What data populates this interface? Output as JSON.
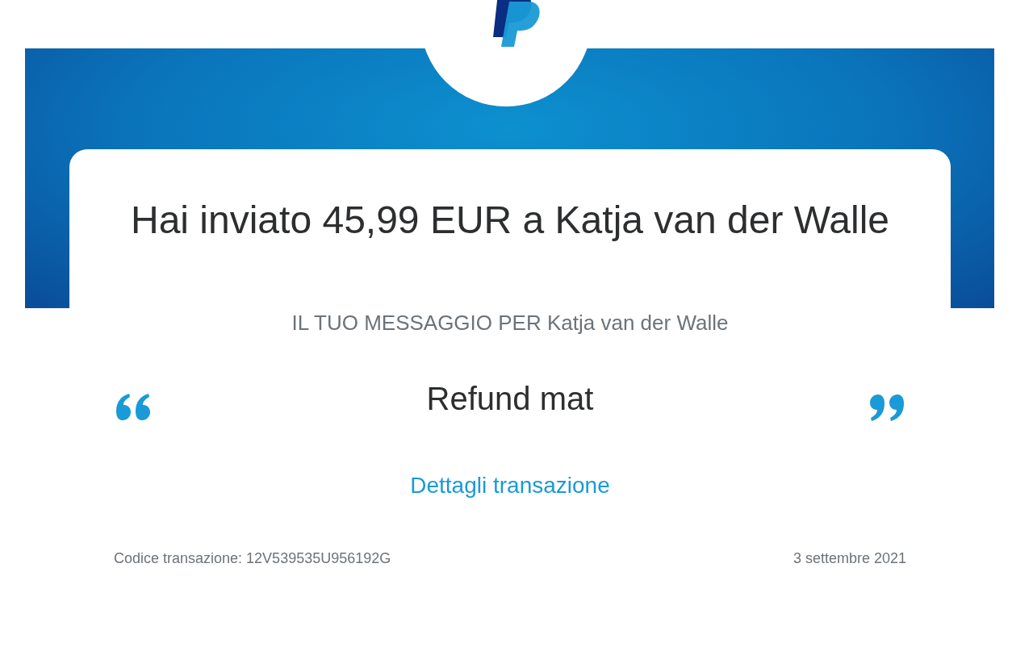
{
  "heading": "Hai inviato 45,99 EUR a Katja van der Walle",
  "message_label": "IL TUO MESSAGGIO PER Katja van der Walle",
  "message": "Refund mat",
  "details_link": "Dettagli transazione",
  "transaction_code": "Codice transazione: 12V539535U956192G",
  "date": "3 settembre 2021"
}
